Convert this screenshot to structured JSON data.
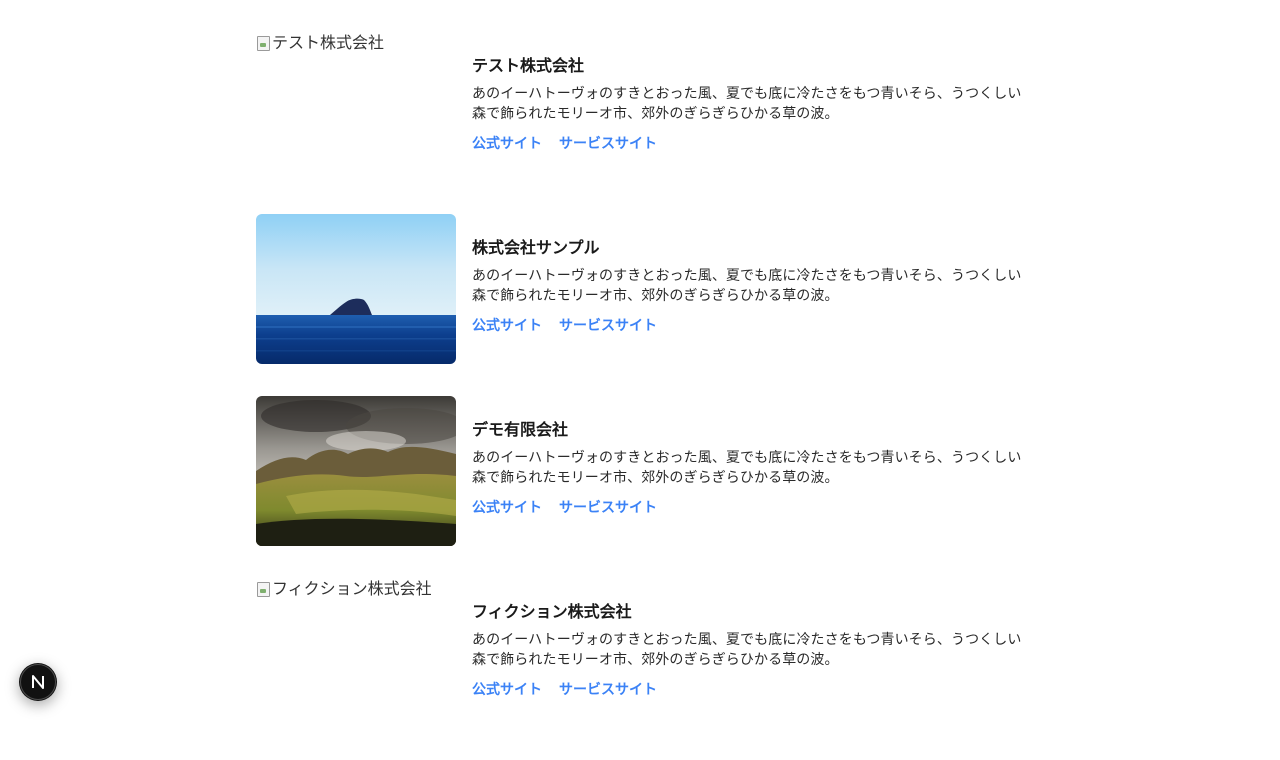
{
  "companies": [
    {
      "name": "テスト株式会社",
      "image_alt": "テスト株式会社",
      "image_loaded": false,
      "description": "あのイーハトーヴォのすきとおった風、夏でも底に冷たさをもつ青いそら、うつくしい森で飾られたモリーオ市、郊外のぎらぎらひかる草の波。",
      "links": [
        "公式サイト",
        "サービスサイト"
      ]
    },
    {
      "name": "株式会社サンプル",
      "image_alt": "株式会社サンプル",
      "image_loaded": true,
      "image_subject": "sea-rock-photo",
      "description": "あのイーハトーヴォのすきとおった風、夏でも底に冷たさをもつ青いそら、うつくしい森で飾られたモリーオ市、郊外のぎらぎらひかる草の波。",
      "links": [
        "公式サイト",
        "サービスサイト"
      ]
    },
    {
      "name": "デモ有限会社",
      "image_alt": "デモ有限会社",
      "image_loaded": true,
      "image_subject": "mountain-valley-photo",
      "description": "あのイーハトーヴォのすきとおった風、夏でも底に冷たさをもつ青いそら、うつくしい森で飾られたモリーオ市、郊外のぎらぎらひかる草の波。",
      "links": [
        "公式サイト",
        "サービスサイト"
      ]
    },
    {
      "name": "フィクション株式会社",
      "image_alt": "フィクション株式会社",
      "image_loaded": false,
      "description": "あのイーハトーヴォのすきとおった風、夏でも底に冷たさをもつ青いそら、うつくしい森で飾られたモリーオ市、郊外のぎらぎらひかる草の波。",
      "links": [
        "公式サイト",
        "サービスサイト"
      ]
    }
  ],
  "dev_badge": {
    "icon": "nextjs-logo-icon",
    "letter": "N"
  },
  "colors": {
    "link": "#3b82f6",
    "text": "#1f1f1f",
    "badge": "#111111"
  }
}
